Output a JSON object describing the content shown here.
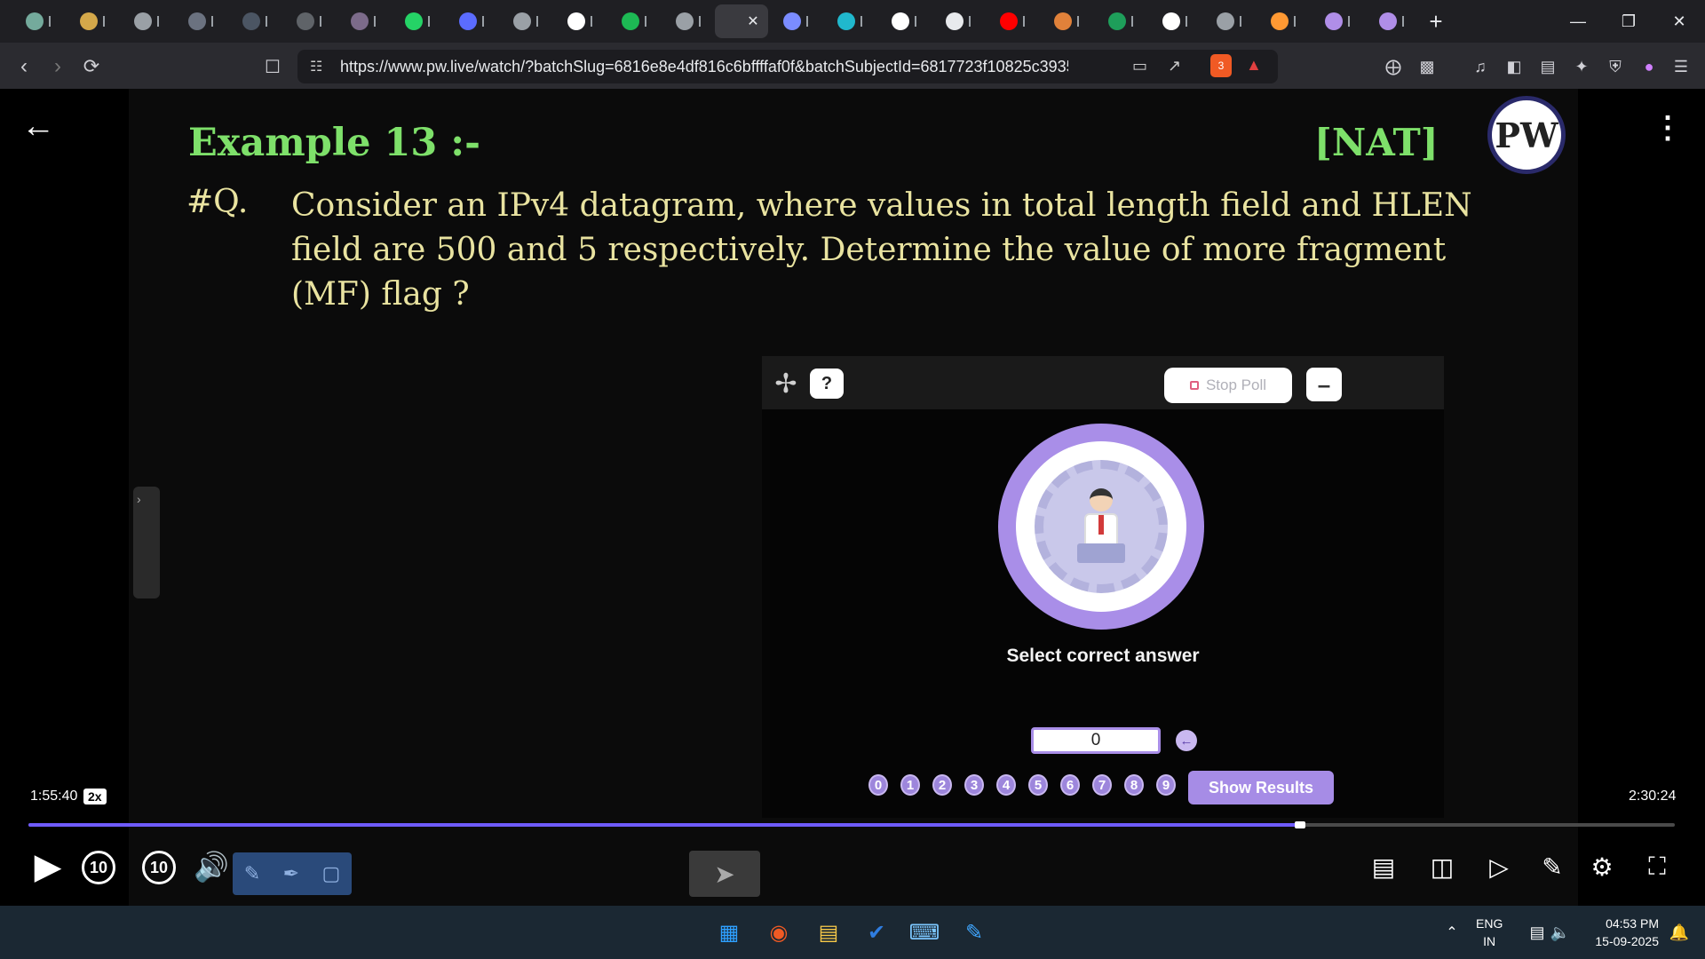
{
  "browser": {
    "tabs": [
      {
        "icon": "chatgpt-icon",
        "color": "#74aa9c"
      },
      {
        "icon": "swirl-icon",
        "color": "#d4a84a"
      },
      {
        "icon": "globe-icon",
        "color": "#9aa0a6"
      },
      {
        "icon": "avatar-icon",
        "color": "#6b7280"
      },
      {
        "icon": "w3schools-icon",
        "color": "#4b5563"
      },
      {
        "icon": "cert-icon",
        "color": "#5f6368"
      },
      {
        "icon": "avatar-icon",
        "color": "#7c6b8a"
      },
      {
        "icon": "whatsapp-icon",
        "color": "#25d366"
      },
      {
        "icon": "bookmark-icon",
        "color": "#5b6cff"
      },
      {
        "icon": "orbit-icon",
        "color": "#9aa0a6"
      },
      {
        "icon": "google-icon",
        "color": "#ffffff"
      },
      {
        "icon": "spotify-icon",
        "color": "#1db954"
      },
      {
        "icon": "globe-icon",
        "color": "#9aa0a6"
      },
      {
        "icon": "active-tab-icon",
        "color": "#ffffff"
      },
      {
        "icon": "gemini-icon",
        "color": "#7b8cff"
      },
      {
        "icon": "perplexity-icon",
        "color": "#20b8cd"
      },
      {
        "icon": "google-icon",
        "color": "#ffffff"
      },
      {
        "icon": "monitor-icon",
        "color": "#e8eaed"
      },
      {
        "icon": "youtube-icon",
        "color": "#ff0000"
      },
      {
        "icon": "burger-icon",
        "color": "#e0813a"
      },
      {
        "icon": "chart-icon",
        "color": "#1e9e5a"
      },
      {
        "icon": "wikipedia-icon",
        "color": "#ffffff"
      },
      {
        "icon": "globe-icon",
        "color": "#9aa0a6"
      },
      {
        "icon": "india-flag-icon",
        "color": "#ff9933"
      },
      {
        "icon": "circle-icon",
        "color": "#b08ee8"
      },
      {
        "icon": "circle-icon",
        "color": "#b08ee8"
      }
    ],
    "url": "https://www.pw.live/watch/?batchSlug=6816e8e4df816c6bffffaf0f&batchSubjectId=6817723f10825c3935224a9...",
    "brave_badge": "3"
  },
  "slide": {
    "example": "Example 13 :-",
    "tag": "[NAT]",
    "logo": "PW",
    "q_label": "#Q.",
    "q_text": "Consider an IPv4 datagram, where values in total length field and HLEN field are 500 and 5 respectively. Determine the value of more fragment (MF) flag ?"
  },
  "poll": {
    "stop_label": "Stop Poll",
    "select_label": "Select correct answer",
    "answer_value": "0",
    "keys": [
      "0",
      "1",
      "2",
      "3",
      "4",
      "5",
      "6",
      "7",
      "8",
      "9"
    ],
    "show_results": "Show Results"
  },
  "player": {
    "elapsed": "1:55:40",
    "speed": "2x",
    "total": "2:30:24",
    "progress": 0.7725,
    "rewind": "10",
    "forward": "10"
  },
  "taskbar": {
    "lang_top": "ENG",
    "lang_bottom": "IN",
    "time": "04:53 PM",
    "date": "15-09-2025"
  }
}
